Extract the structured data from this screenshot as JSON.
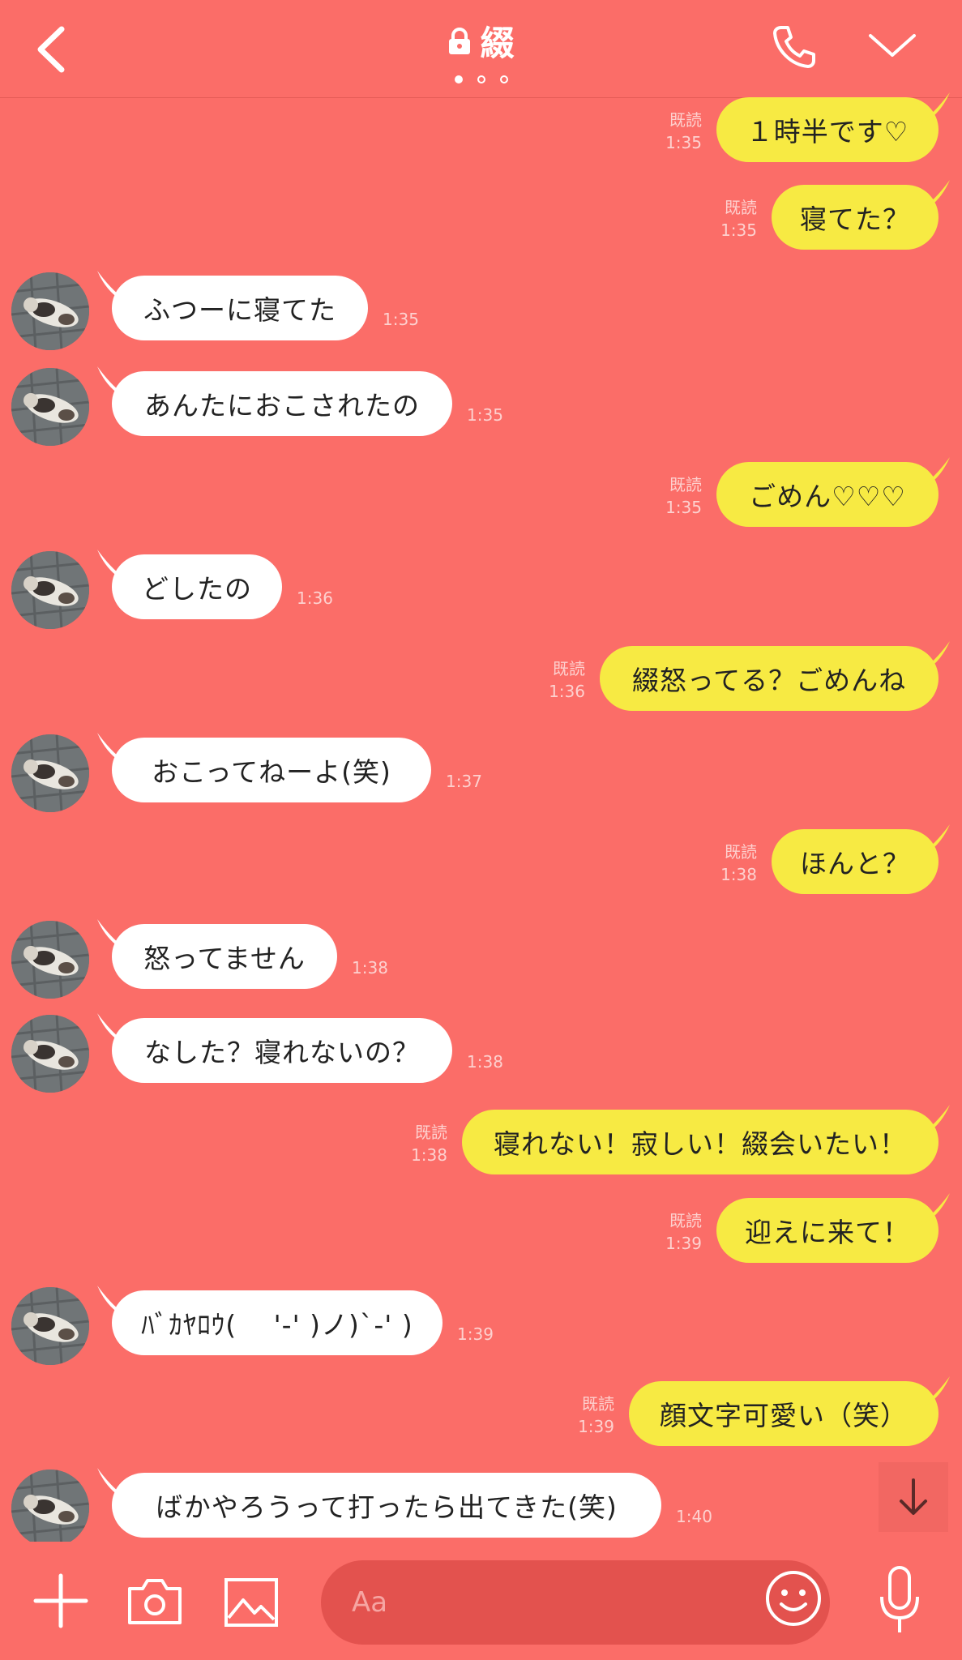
{
  "header": {
    "title": "綴",
    "page_dots": 3,
    "active_dot": 0
  },
  "messages": [
    {
      "side": "sent",
      "text": "１時半です♡",
      "read": "既読",
      "time": "1:35"
    },
    {
      "side": "sent",
      "text": "寝てた？",
      "read": "既読",
      "time": "1:35"
    },
    {
      "side": "recv",
      "text": "ふつーに寝てた",
      "time": "1:35"
    },
    {
      "side": "recv",
      "text": "あんたにおこされたの",
      "time": "1:35"
    },
    {
      "side": "sent",
      "text": "ごめん♡♡♡",
      "read": "既読",
      "time": "1:35"
    },
    {
      "side": "recv",
      "text": "どしたの",
      "time": "1:36"
    },
    {
      "side": "sent",
      "text": "綴怒ってる？ごめんね",
      "read": "既読",
      "time": "1:36"
    },
    {
      "side": "recv",
      "text": "おこってねーよ(笑)",
      "time": "1:37"
    },
    {
      "side": "sent",
      "text": "ほんと？",
      "read": "既読",
      "time": "1:38"
    },
    {
      "side": "recv",
      "text": "怒ってません",
      "time": "1:38"
    },
    {
      "side": "recv",
      "text": "なした？寝れないの？",
      "time": "1:38"
    },
    {
      "side": "sent",
      "text": "寝れない！寂しい！綴会いたい！",
      "read": "既読",
      "time": "1:38"
    },
    {
      "side": "sent",
      "text": "迎えに来て！",
      "read": "既読",
      "time": "1:39"
    },
    {
      "side": "recv",
      "text": "ﾊﾞｶﾔﾛｳ(　 '-' )ノ)`-' )",
      "time": "1:39"
    },
    {
      "side": "sent",
      "text": "顔文字可愛い（笑）",
      "read": "既読",
      "time": "1:39"
    },
    {
      "side": "recv",
      "text": "ばかやろうって打ったら出てきた(笑)",
      "time": "1:40"
    }
  ],
  "input": {
    "placeholder": "Aa"
  },
  "icons": {
    "back": "chevron-left-icon",
    "lock": "lock-icon",
    "call": "phone-icon",
    "menu": "chevron-down-icon",
    "plus": "plus-icon",
    "camera": "camera-icon",
    "image": "image-icon",
    "emoji": "smiley-icon",
    "mic": "microphone-icon",
    "scroll": "arrow-down-icon"
  },
  "colors": {
    "background": "#fb6d68",
    "sent_bubble": "#f7ea43",
    "recv_bubble": "#ffffff"
  }
}
